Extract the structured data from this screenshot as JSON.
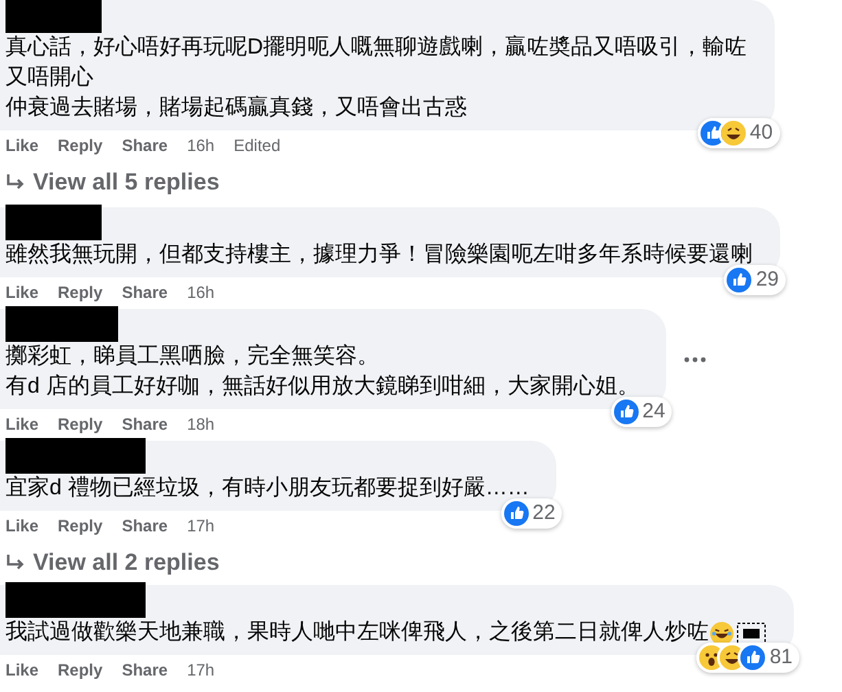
{
  "comments": [
    {
      "lines": [
        "真心話，好心唔好再玩呢D擺明呃人嘅無聊遊戲喇，贏咗奬品又唔吸引，輸咗",
        "又唔開心",
        "仲衰過去賭場，賭場起碼贏真錢，又唔會出古惑"
      ],
      "has_menu": false,
      "reactions": {
        "icons": [
          {
            "kind": "like"
          },
          {
            "kind": "haha"
          }
        ],
        "count": "40"
      },
      "actions": [
        "Like",
        "Reply",
        "Share"
      ],
      "time": "16h",
      "edited": "Edited",
      "replies_link": "View all 5 replies"
    },
    {
      "lines": [
        "雖然我無玩開，但都支持樓主，據理力爭！冒險樂園呃左咁多年系時候要還喇"
      ],
      "has_menu": false,
      "reactions": {
        "icons": [
          {
            "kind": "like"
          }
        ],
        "count": "29"
      },
      "actions": [
        "Like",
        "Reply",
        "Share"
      ],
      "time": "16h"
    },
    {
      "lines": [
        "擲彩虹，睇員工黑哂臉，完全無笑容。",
        "有d 店的員工好好咖，無話好似用放大鏡睇到咁細，大家開心姐。"
      ],
      "has_menu": true,
      "reactions": {
        "icons": [
          {
            "kind": "like"
          }
        ],
        "count": "24"
      },
      "actions": [
        "Like",
        "Reply",
        "Share"
      ],
      "time": "18h"
    },
    {
      "lines": [
        "宜家d 禮物已經垃圾，有時小朋友玩都要捉到好嚴……"
      ],
      "has_menu": false,
      "reactions": {
        "icons": [
          {
            "kind": "like"
          }
        ],
        "count": "22"
      },
      "actions": [
        "Like",
        "Reply",
        "Share"
      ],
      "time": "17h",
      "replies_link": "View all 2 replies"
    },
    {
      "lines": [
        "我試過做歡樂天地兼職，果時人哋中左咪俾飛人，之後第二日就俾人炒咗"
      ],
      "trailing": [
        {
          "kind": "laugh"
        },
        {
          "kind": "object"
        }
      ],
      "has_menu": false,
      "reactions": {
        "icons": [
          {
            "kind": "wow"
          },
          {
            "kind": "haha"
          },
          {
            "kind": "like"
          }
        ],
        "count": "81"
      },
      "actions": [
        "Like",
        "Reply",
        "Share"
      ],
      "time": "17h"
    }
  ]
}
